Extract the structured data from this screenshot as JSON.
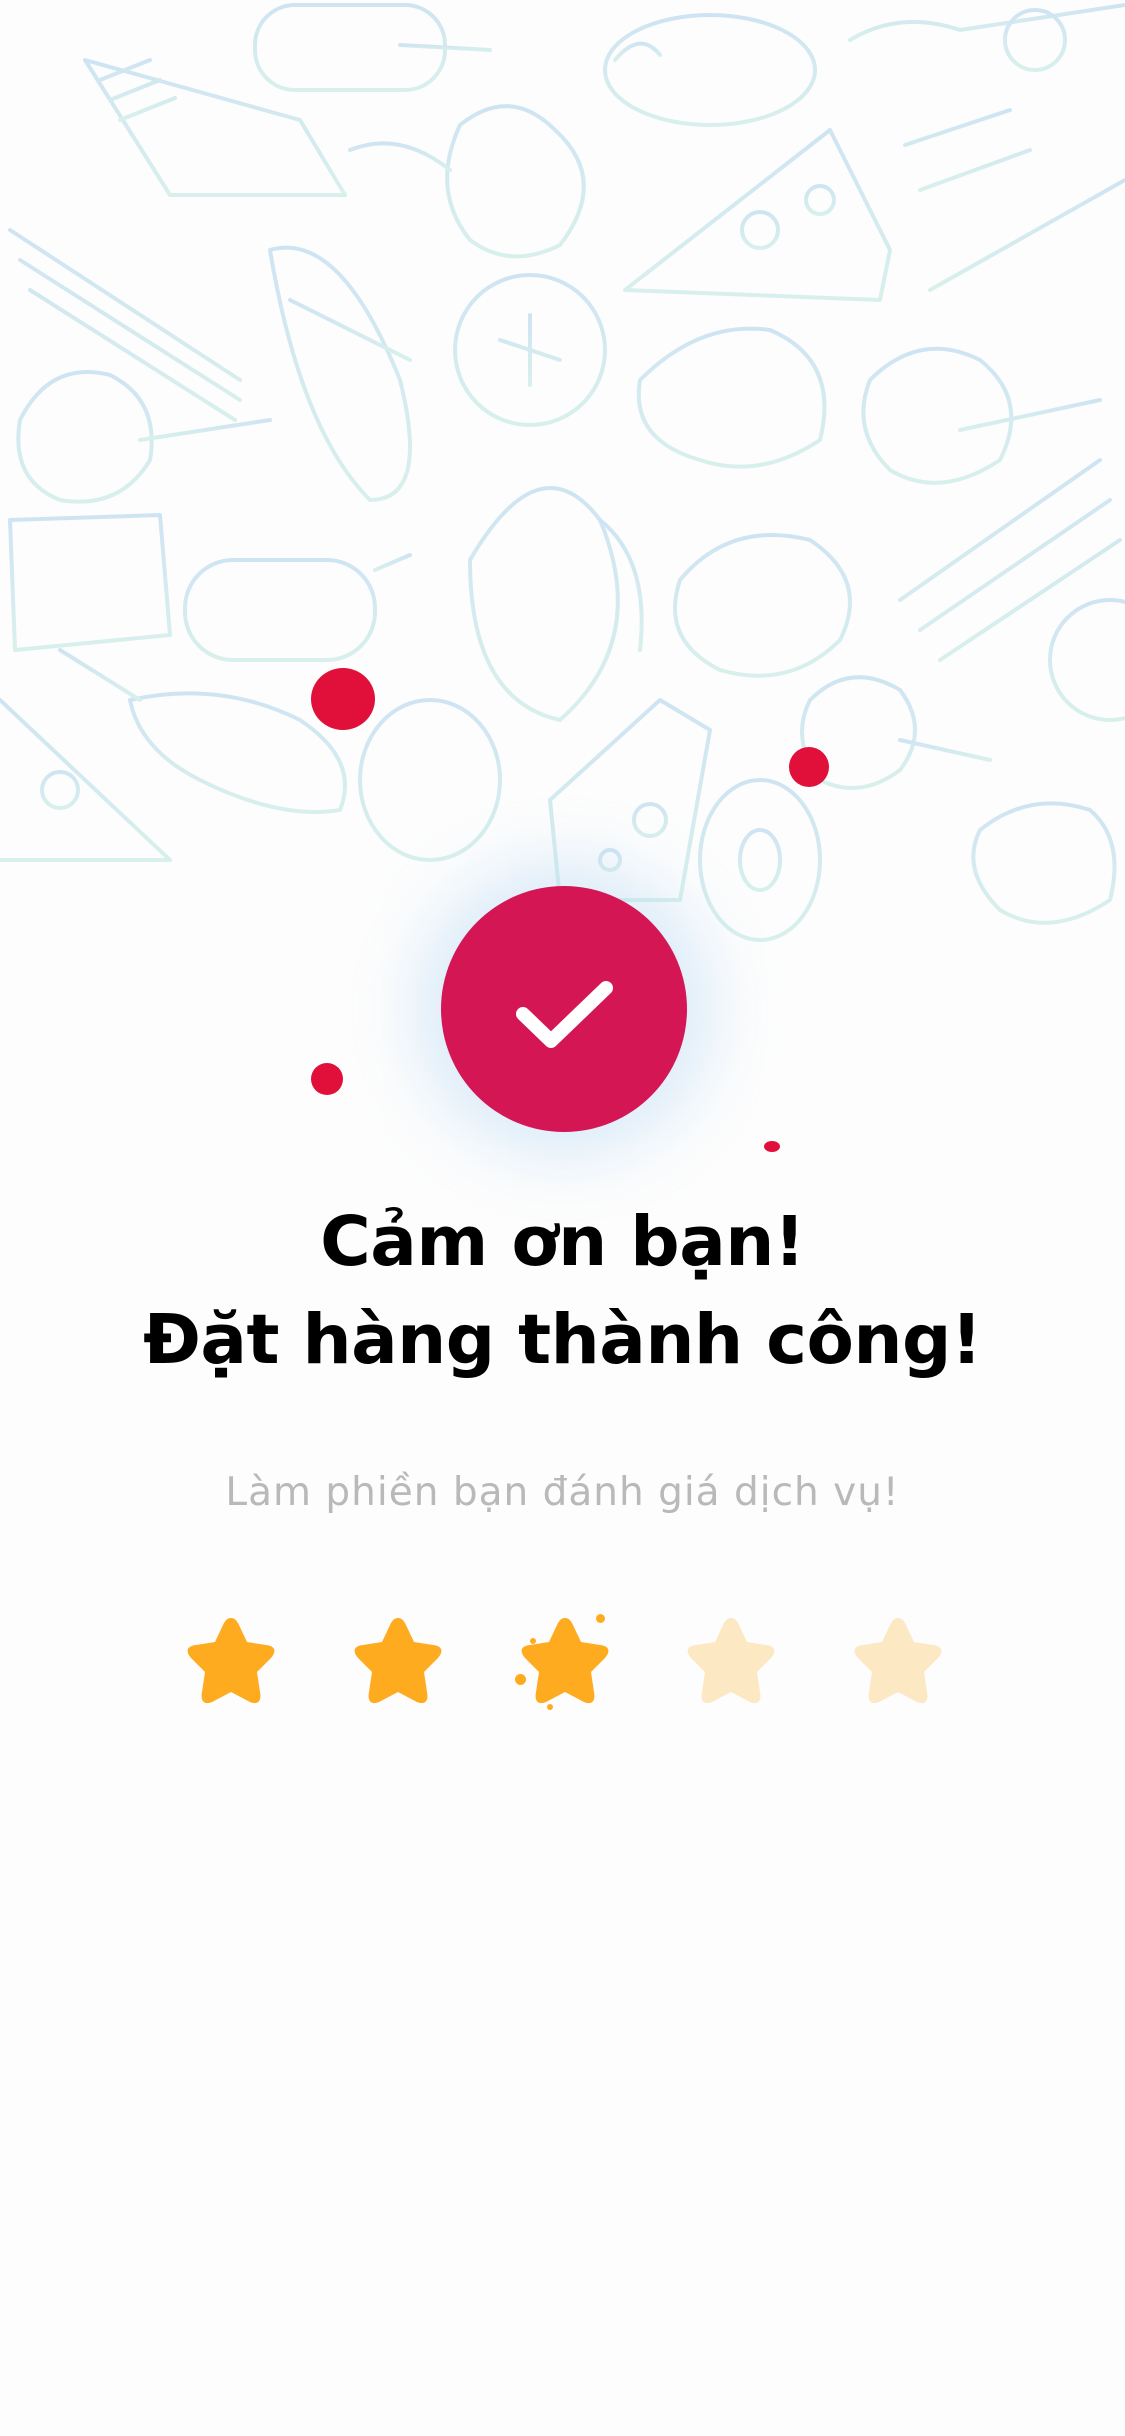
{
  "confirmation": {
    "title_line1": "Cảm ơn bạn!",
    "title_line2": "Đặt hàng thành công!",
    "subtitle": "Làm phiền bạn đánh giá dịch vụ!"
  },
  "rating": {
    "value": 3,
    "max": 5,
    "filled_color": "#ffab1f",
    "empty_color": "#fde8c4"
  },
  "colors": {
    "accent": "#d51654",
    "confetti": "#e0103a",
    "doodle_stroke": "#bfe3ea"
  },
  "icons": {
    "success": "checkmark-icon",
    "star": "star-icon",
    "background": "food-doodle-pattern"
  }
}
